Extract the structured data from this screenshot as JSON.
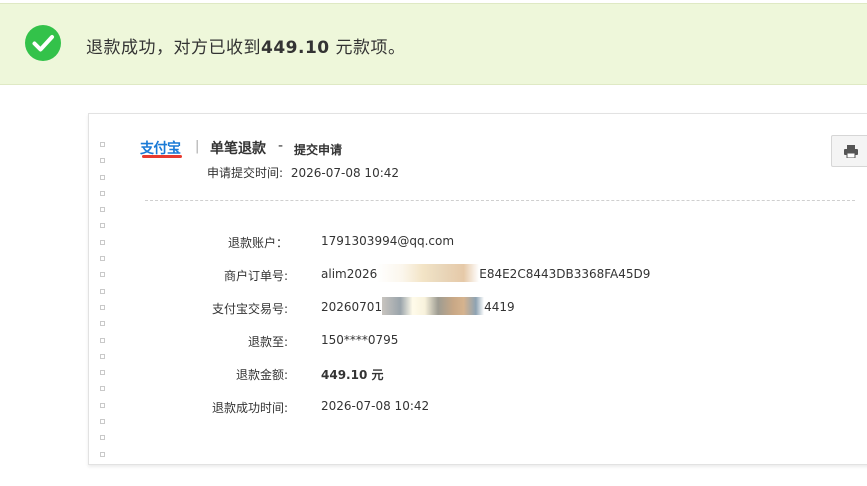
{
  "banner": {
    "message_prefix": "退款成功，对方已收到",
    "amount": "449.10",
    "message_suffix": " 元款项。",
    "icon": "check-circle-icon"
  },
  "receipt": {
    "logo_text": "支付宝",
    "separator": "|",
    "title": "单笔退款",
    "dash": "-",
    "subtitle": "提交申请",
    "submit_time_label": "申请提交时间:",
    "submit_time_value": "2026-07-08 10:42",
    "print_icon": "printer-icon",
    "fields": [
      {
        "label": "退款账户：",
        "value": "1791303994@qq.com"
      },
      {
        "label": "商户订单号:",
        "value_start": "alim2026",
        "value_end": "E84E2C8443DB3368FA45D9"
      },
      {
        "label": "支付宝交易号:",
        "value_start": "20260701",
        "value_end": "4419"
      },
      {
        "label": "退款至:",
        "value": "150****0795"
      },
      {
        "label": "退款金额:",
        "value": "449.10 元"
      },
      {
        "label": "退款成功时间:",
        "value": "2026-07-08 10:42"
      }
    ]
  },
  "colors": {
    "banner_bg": "#eef7da",
    "success_green": "#33c24a",
    "alipay_blue": "#1a7ad6"
  }
}
